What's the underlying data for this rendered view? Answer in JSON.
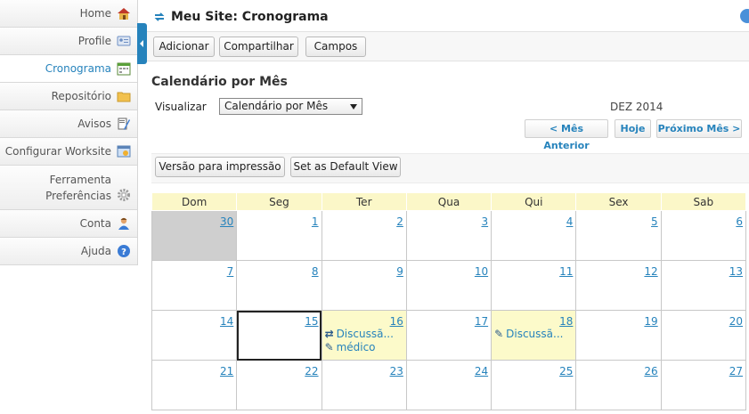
{
  "sidebar": {
    "items": [
      {
        "label": "Home",
        "icon": "home-icon"
      },
      {
        "label": "Profile",
        "icon": "profile-card-icon"
      },
      {
        "label": "Cronograma",
        "icon": "calendar-icon",
        "active": true
      },
      {
        "label": "Repositório",
        "icon": "folder-icon"
      },
      {
        "label": "Avisos",
        "icon": "announcement-icon"
      },
      {
        "label": "Configurar Worksite",
        "icon": "site-settings-icon"
      },
      {
        "label_line1": "Ferramenta",
        "label_line2": "Preferências",
        "icon": "gear-icon"
      },
      {
        "label": "Conta",
        "icon": "user-icon"
      },
      {
        "label": "Ajuda",
        "icon": "help-icon"
      }
    ]
  },
  "header": {
    "title": "Meu Site: Cronograma"
  },
  "toolbar": {
    "add_label": "Adicionar",
    "share_label": "Compartilhar",
    "fields_label": "Campos"
  },
  "calendar_view": {
    "title": "Calendário por Mês",
    "view_label": "Visualizar",
    "view_selected": "Calendário por Mês",
    "month_label": "DEZ 2014",
    "prev_label": "< Mês Anterior",
    "today_label": "Hoje",
    "next_label": "Próximo Mês >",
    "print_label": "Versão para impressão",
    "default_view_label": "Set as Default View"
  },
  "calendar": {
    "weekdays": [
      "Dom",
      "Seg",
      "Ter",
      "Qua",
      "Qui",
      "Sex",
      "Sab"
    ],
    "weeks": [
      [
        "30",
        "1",
        "2",
        "3",
        "4",
        "5",
        "6"
      ],
      [
        "7",
        "8",
        "9",
        "10",
        "11",
        "12",
        "13"
      ],
      [
        "14",
        "15",
        "16",
        "17",
        "18",
        "19",
        "20"
      ],
      [
        "21",
        "22",
        "23",
        "24",
        "25",
        "26",
        "27"
      ]
    ],
    "events": {
      "16": [
        "Discussã...",
        "médico"
      ],
      "18": [
        "Discussã..."
      ]
    }
  },
  "colors": {
    "accent": "#2683bc",
    "header_yellow": "#fbf7c8",
    "event_yellow": "#fcfaca"
  }
}
